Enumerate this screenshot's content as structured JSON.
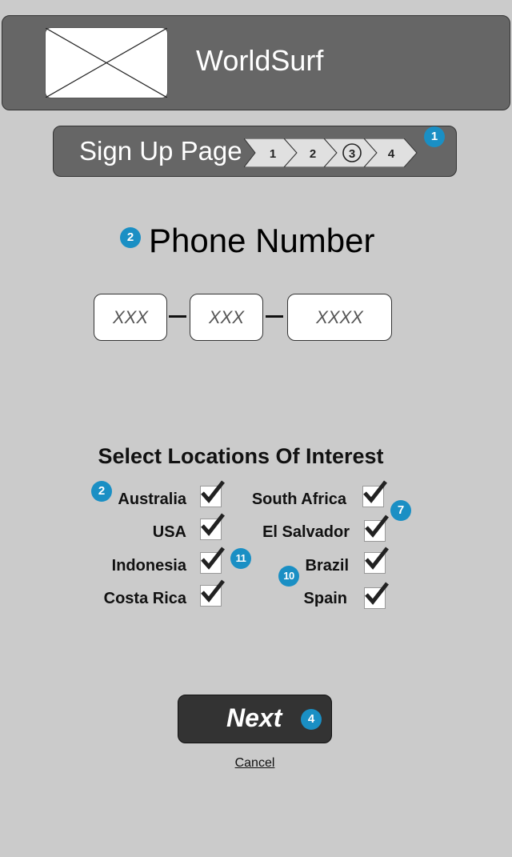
{
  "header": {
    "logo": "image-placeholder",
    "brand": "WorldSurf"
  },
  "signup": {
    "title": "Sign Up Page",
    "steps": [
      "1",
      "2",
      "3",
      "4"
    ],
    "current_step": 3
  },
  "phone": {
    "title": "Phone Number",
    "fields": [
      {
        "placeholder": "XXX",
        "value": ""
      },
      {
        "placeholder": "XXX",
        "value": ""
      },
      {
        "placeholder": "XXXX",
        "value": ""
      }
    ]
  },
  "locations": {
    "title": "Select Locations Of Interest",
    "left": [
      {
        "label": "Australia",
        "checked": true
      },
      {
        "label": "USA",
        "checked": true
      },
      {
        "label": "Indonesia",
        "checked": true
      },
      {
        "label": "Costa Rica",
        "checked": true
      }
    ],
    "right": [
      {
        "label": "South Africa",
        "checked": true
      },
      {
        "label": "El Salvador",
        "checked": true
      },
      {
        "label": "Brazil",
        "checked": true
      },
      {
        "label": "Spain",
        "checked": true
      }
    ]
  },
  "badges": {
    "steps": "1",
    "phone": "2",
    "locations": "2",
    "right_column": "7",
    "indonesia": "11",
    "brazil": "10",
    "next": "4"
  },
  "actions": {
    "next_label": "Next",
    "cancel_label": "Cancel"
  },
  "colors": {
    "background": "#cbcbcb",
    "header": "#666666",
    "badge": "#1a8fc4",
    "button": "#333333"
  }
}
